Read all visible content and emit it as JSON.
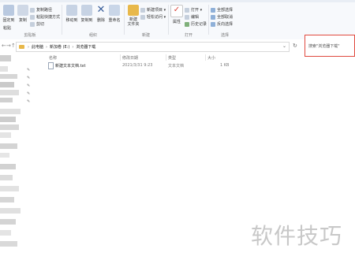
{
  "ribbon": {
    "clipboard": {
      "pin_label": "固定到",
      "copy_label": "复制",
      "paste_label": "粘贴",
      "copy_path_label": "复制路径",
      "paste_shortcut_label": "粘贴快捷方式",
      "cut_label": "剪切",
      "group_label": "剪贴板"
    },
    "organize": {
      "move_label": "移动到",
      "copy_to_label": "复制到",
      "delete_label": "删除",
      "rename_label": "重命名",
      "group_label": "组织"
    },
    "new": {
      "new_folder_label": "新建\n文件夹",
      "new_item_label": "新建项目 ▾",
      "easy_access_label": "轻松访问 ▾",
      "group_label": "新建"
    },
    "open": {
      "properties_label": "属性",
      "open_label": "打开 ▾",
      "edit_label": "编辑",
      "history_label": "历史记录",
      "group_label": "打开"
    },
    "select": {
      "select_all_label": "全部选择",
      "select_none_label": "全部取消",
      "invert_label": "反向选择",
      "group_label": "选择"
    }
  },
  "address": {
    "back": "←",
    "forward": "→",
    "up": "↑",
    "crumbs": [
      "此电脑",
      "新加卷 (E:)",
      "浏览器下载"
    ],
    "refresh": "↻"
  },
  "search": {
    "placeholder": "搜索\"浏览器下载\""
  },
  "columns": {
    "name": "名称",
    "date": "修改日期",
    "type": "类型",
    "size": "大小"
  },
  "files": [
    {
      "name": "新建文本文档.txt",
      "date": "2021/3/31 9:23",
      "type": "文本文档",
      "size": "1 KB"
    }
  ],
  "watermark": "软件技巧",
  "colors": {
    "search_highlight": "#e04a3f",
    "folder": "#e8b84a",
    "ribbon_bg": "#f7f9fc"
  }
}
